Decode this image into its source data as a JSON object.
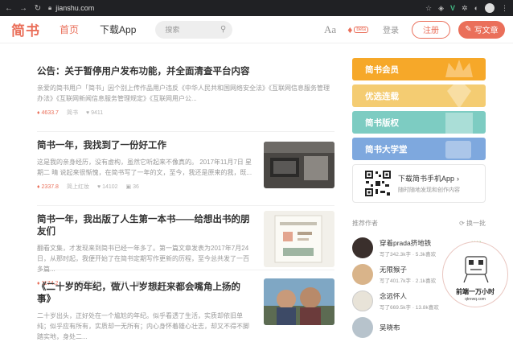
{
  "browser": {
    "url": "jianshu.com"
  },
  "header": {
    "logo": "简书",
    "nav_home": "首页",
    "nav_app": "下载App",
    "search_placeholder": "搜索",
    "aa_label": "Aa",
    "beta_label": "beta",
    "login": "登录",
    "register": "注册",
    "write": "写文章"
  },
  "articles": [
    {
      "title": "公告：关于暂停用户发布功能，并全面清查平台内容",
      "abstract": "亲爱的简书用户「简书」因个别上传作品用户违反《中华人民共和国网络安全法》《互联网信息服务管理办法》《互联网新闻信息服务管理规定》《互联网用户公...",
      "diamond": "4633.7",
      "author": "简书",
      "likes": "9411"
    },
    {
      "title": "简书一年，我找到了一份好工作",
      "abstract": "这是我的亲身经历，没有虚构，虽然它听起来不像真的。 2017年11月7日 星期二 晴 说起来很惭愧，在简书写了一年的文，至今，我还是原来的我，既...",
      "diamond": "2337.8",
      "author": "简上红妆",
      "likes": "14102",
      "comments": "36"
    },
    {
      "title": "简书一年，我出版了人生第一本书——给想出书的朋友们",
      "abstract": "翻看文集，才发现来到简书已经一年多了。第一篇文章发表为2017年7月24日，从那时起，我便开始了在简书定期写作更新的历程，至今总共发了一百多篇...",
      "diamond": "1174.2",
      "author": "Rosa的南丝儿",
      "likes": "5334",
      "comments": "1"
    },
    {
      "title": "《二十岁的年纪，做八十岁想赶来都会嘴角上扬的事》",
      "abstract": "二十岁出头，正好处在一个尴尬的年纪。似乎看透了生活，实质却依旧单纯；似乎应有所有，实质却一无所有；内心身怀着雄心壮志，却又不得不脚踏实地，身处二..."
    }
  ],
  "sidebar": {
    "banners": [
      "简书会员",
      "优选连载",
      "简书版权",
      "简书大学堂"
    ],
    "app_title": "下载简书手机App",
    "app_subtitle": "随时随地发现和创作内容",
    "recommend_title": "推荐作者",
    "refresh": "换一批",
    "follow_label": "+ 关注",
    "authors": [
      {
        "name": "穿着prada挤地铁",
        "stats": "写了342.3k字 · 5.3k喜欢"
      },
      {
        "name": "无限猴子",
        "stats": "写了401.7k字 · 2.1k喜欢"
      },
      {
        "name": "念远怀人",
        "stats": "写了669.5k字 · 13.8k喜欢"
      },
      {
        "name": "吴晓布",
        "stats": ""
      }
    ]
  },
  "float_ad": {
    "title": "前端一万小时",
    "subtitle": "qtrewq.com"
  },
  "colors": {
    "brand": "#ea6f5a",
    "follow": "#42c02e"
  }
}
